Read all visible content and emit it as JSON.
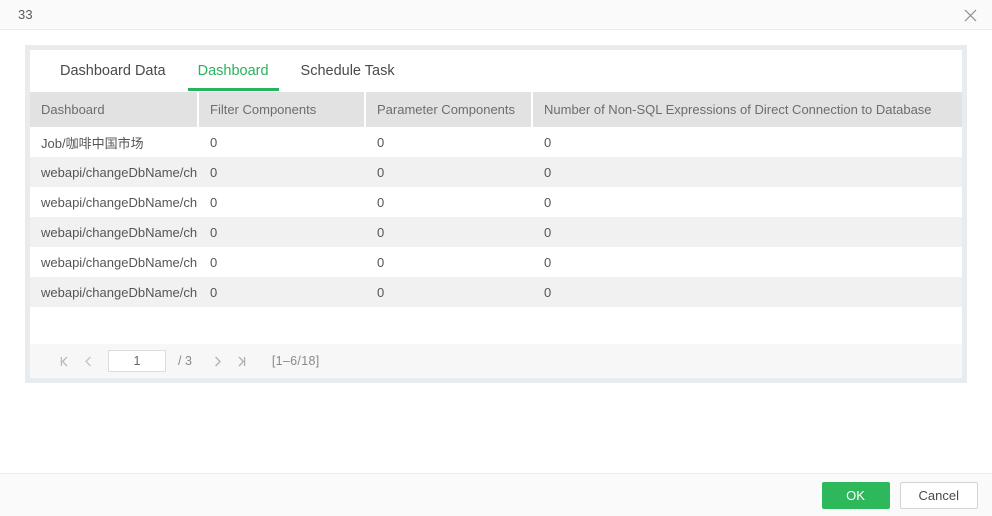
{
  "window": {
    "title": "33",
    "close_icon": "close-icon"
  },
  "tabs": [
    {
      "label": "Dashboard Data",
      "active": false
    },
    {
      "label": "Dashboard",
      "active": true
    },
    {
      "label": "Schedule Task",
      "active": false
    }
  ],
  "table": {
    "columns": [
      "Dashboard",
      "Filter Components",
      "Parameter Components",
      "Number of Non-SQL Expressions of Direct Connection to Database"
    ],
    "rows": [
      {
        "dashboard": "Job/咖啡中国市场",
        "filter": "0",
        "parameter": "0",
        "nonsql": "0"
      },
      {
        "dashboard": "webapi/changeDbName/cha",
        "filter": "0",
        "parameter": "0",
        "nonsql": "0"
      },
      {
        "dashboard": "webapi/changeDbName/cha",
        "filter": "0",
        "parameter": "0",
        "nonsql": "0"
      },
      {
        "dashboard": "webapi/changeDbName/cha",
        "filter": "0",
        "parameter": "0",
        "nonsql": "0"
      },
      {
        "dashboard": "webapi/changeDbName/cha",
        "filter": "0",
        "parameter": "0",
        "nonsql": "0"
      },
      {
        "dashboard": "webapi/changeDbName/cha",
        "filter": "0",
        "parameter": "0",
        "nonsql": "0"
      }
    ]
  },
  "pagination": {
    "first_icon": "first-page-icon",
    "prev_icon": "previous-page-icon",
    "page_value": "1",
    "total_pages": "/ 3",
    "next_icon": "next-page-icon",
    "last_icon": "last-page-icon",
    "range": "[1–6/18]"
  },
  "footer": {
    "ok_label": "OK",
    "cancel_label": "Cancel"
  },
  "colors": {
    "accent_green": "#2eb85c",
    "tab_active": "#29b35e",
    "header_bg": "#e2e2e2",
    "row_alt": "#f1f1f1",
    "panel_wrap": "#e9ecee",
    "chrome_bg": "#fafafa"
  }
}
